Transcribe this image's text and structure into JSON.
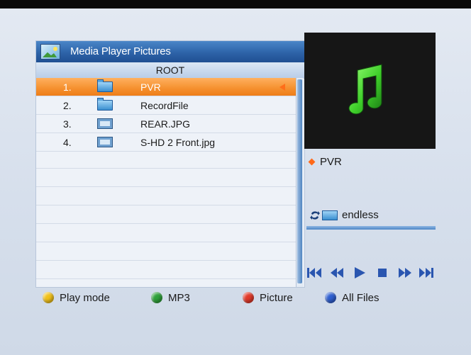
{
  "window": {
    "title": "Media Player Pictures",
    "path": "ROOT"
  },
  "files": [
    {
      "number": "1.",
      "type": "folder",
      "icon": "folder-icon",
      "name": "PVR",
      "selected": true
    },
    {
      "number": "2.",
      "type": "folder",
      "icon": "folder-icon",
      "name": "RecordFile",
      "selected": false
    },
    {
      "number": "3.",
      "type": "image",
      "icon": "image-file-icon",
      "name": "REAR.JPG",
      "selected": false
    },
    {
      "number": "4.",
      "type": "image",
      "icon": "image-file-icon",
      "name": "S-HD 2 Front.jpg",
      "selected": false
    }
  ],
  "preview": {
    "icon": "music-note-icon",
    "current_item": "PVR"
  },
  "repeat": {
    "label": "endless",
    "icon": "repeat-folder-icon"
  },
  "playback_controls": [
    {
      "name": "skip-back-button",
      "icon": "skip-back-icon"
    },
    {
      "name": "rewind-button",
      "icon": "rewind-icon"
    },
    {
      "name": "play-button",
      "icon": "play-icon"
    },
    {
      "name": "stop-button",
      "icon": "stop-icon"
    },
    {
      "name": "fast-forward-button",
      "icon": "fast-forward-icon"
    },
    {
      "name": "skip-forward-button",
      "icon": "skip-forward-icon"
    }
  ],
  "legend": [
    {
      "color": "yellow",
      "hex": "#f2c21a",
      "label": "Play mode"
    },
    {
      "color": "green",
      "hex": "#2fa23a",
      "label": "MP3"
    },
    {
      "color": "red",
      "hex": "#e23a2a",
      "label": "Picture"
    },
    {
      "color": "blue",
      "hex": "#2f5fd0",
      "label": "All Files"
    }
  ],
  "colors": {
    "selection": "#f5902e",
    "title_bar": "#2d63a8",
    "accent_marker": "#ff6a1a"
  }
}
